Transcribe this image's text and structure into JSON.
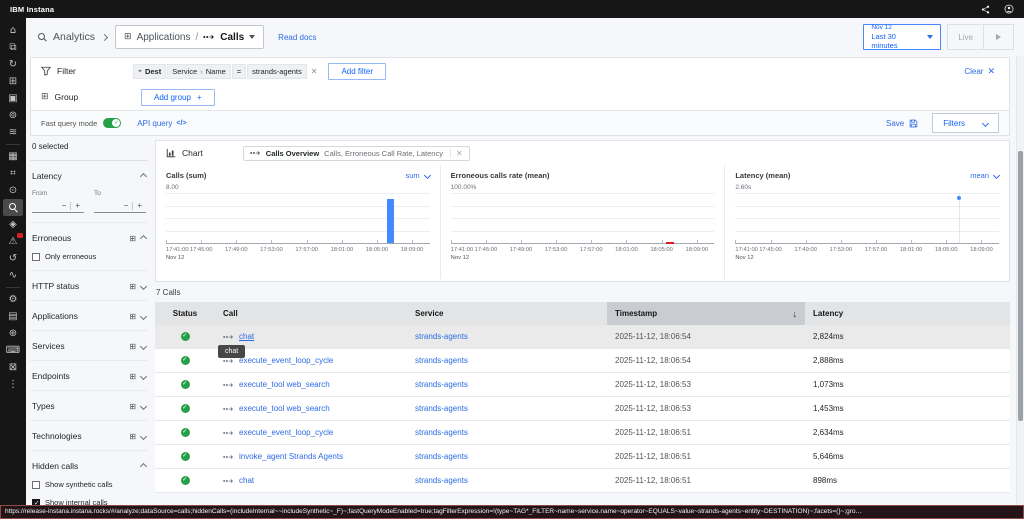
{
  "topbar": {
    "brand": "IBM Instana"
  },
  "rail": {
    "items": [
      {
        "name": "home",
        "glyph": "⌂"
      },
      {
        "name": "dashboards",
        "glyph": "⧉"
      },
      {
        "name": "deployments",
        "glyph": "↻"
      },
      {
        "name": "applications",
        "glyph": "⊞"
      },
      {
        "name": "ai-insights",
        "glyph": "▣"
      },
      {
        "name": "business-perspectives",
        "glyph": "⊚"
      },
      {
        "name": "platform",
        "glyph": "≋"
      },
      {
        "divider": true
      },
      {
        "name": "infrastructure",
        "glyph": "▦"
      },
      {
        "name": "websites",
        "glyph": "⌗"
      },
      {
        "name": "synthetic-monitoring",
        "glyph": "⊙"
      },
      {
        "name": "analytics",
        "glyph": "",
        "active": true,
        "magnifier": true
      },
      {
        "name": "application-security",
        "glyph": "◈"
      },
      {
        "name": "events",
        "glyph": "⚠",
        "badge": true
      },
      {
        "name": "automation",
        "glyph": "↺"
      },
      {
        "name": "service-levels",
        "glyph": "∿"
      },
      {
        "divider": true
      },
      {
        "name": "settings",
        "glyph": "⚙"
      },
      {
        "name": "documentation",
        "glyph": "▤"
      },
      {
        "name": "invite-users",
        "glyph": "⊕"
      },
      {
        "name": "integrations",
        "glyph": "⌨"
      },
      {
        "name": "lock",
        "glyph": "⊠"
      },
      {
        "name": "more",
        "glyph": "⋮"
      }
    ]
  },
  "header": {
    "analytics": "Analytics",
    "applications": "Applications",
    "calls": "Calls",
    "read_docs": "Read docs",
    "time_date": "Nov 12",
    "time_range": "Last 30 minutes",
    "live": "Live"
  },
  "filterbar": {
    "filter_label": "Filter",
    "chip_scope": "Dest",
    "chip_tag_group": "Service",
    "chip_tag_sep": "›",
    "chip_tag": "Name",
    "chip_operator": "=",
    "chip_value": "strands-agents",
    "add_filter": "Add filter",
    "clear": "Clear",
    "group_label": "Group",
    "add_group": "Add group",
    "add_group_plus": "+",
    "fast_query_mode": "Fast query mode",
    "api_query": "API query",
    "api_query_icon": "</>",
    "save": "Save",
    "filters_button": "Filters"
  },
  "facets": {
    "selected_count": "0 selected",
    "latency": {
      "label": "Latency",
      "from": "From",
      "to": "To",
      "minus": "−",
      "plus": "+"
    },
    "erroneous": {
      "label": "Erroneous",
      "only_erroneous": "Only erroneous"
    },
    "collapsed": [
      {
        "label": "HTTP status"
      },
      {
        "label": "Applications"
      },
      {
        "label": "Services"
      },
      {
        "label": "Endpoints"
      },
      {
        "label": "Types"
      },
      {
        "label": "Technologies"
      }
    ],
    "hidden_calls": {
      "label": "Hidden calls",
      "show_synthetic": "Show synthetic calls",
      "show_internal": "Show internal calls",
      "synthetic_checked": false,
      "internal_checked": true
    }
  },
  "chart_section": {
    "chart_label": "Chart",
    "chip_title": "Calls Overview",
    "chip_subtitle": "Calls, Erroneous Call Rate, Latency"
  },
  "chart_data": [
    {
      "type": "bar",
      "title": "Calls (sum)",
      "aggregation": "sum",
      "ylim": [
        0,
        8
      ],
      "ymax_label": "8.00",
      "axis_start": "17:41:00",
      "axis_minutes": 30,
      "x_ticks": [
        "17:41:00",
        "17:45:00",
        "17:49:00",
        "17:53:00",
        "17:57:00",
        "18:01:00",
        "18:05:00",
        "18:09:00"
      ],
      "x_date_label": "Nov 12",
      "grid": true,
      "series": [
        {
          "name": "Calls",
          "points": [
            {
              "x": "18:06:30",
              "value": 7
            }
          ]
        }
      ]
    },
    {
      "type": "line",
      "title": "Erroneous calls rate (mean)",
      "ylim": [
        0,
        100
      ],
      "ymax_label": "100.00%",
      "axis_start": "17:41:00",
      "axis_minutes": 30,
      "x_ticks": [
        "17:41:00",
        "17:45:00",
        "17:49:00",
        "17:53:00",
        "17:57:00",
        "18:01:00",
        "18:05:00",
        "18:09:00"
      ],
      "x_date_label": "Nov 12",
      "grid": true,
      "series": [
        {
          "name": "Erroneous calls rate",
          "points": [
            {
              "x": "18:06:00",
              "value": 0
            }
          ]
        }
      ]
    },
    {
      "type": "scatter",
      "title": "Latency (mean)",
      "aggregation": "mean",
      "ylim": [
        0,
        2.6
      ],
      "ymax_label": "2.60s",
      "axis_start": "17:41:00",
      "axis_minutes": 30,
      "x_ticks": [
        "17:41:00",
        "17:45:00",
        "17:49:00",
        "17:53:00",
        "17:57:00",
        "18:01:00",
        "18:05:00",
        "18:09:00"
      ],
      "x_date_label": "Nov 12",
      "grid": true,
      "series": [
        {
          "name": "Latency",
          "points": [
            {
              "x": "18:06:30",
              "value": 2.43
            }
          ]
        }
      ]
    }
  ],
  "table": {
    "count_label": "7 Calls",
    "columns": {
      "status": "Status",
      "call": "Call",
      "service": "Service",
      "timestamp": "Timestamp",
      "latency": "Latency"
    },
    "tooltip": "chat",
    "rows": [
      {
        "call": "chat",
        "service": "strands-agents",
        "timestamp": "2025-11-12, 18:06:54",
        "latency": "2,824ms"
      },
      {
        "call": "execute_event_loop_cycle",
        "service": "strands-agents",
        "timestamp": "2025-11-12, 18:06:54",
        "latency": "2,888ms"
      },
      {
        "call": "execute_tool web_search",
        "service": "strands-agents",
        "timestamp": "2025-11-12, 18:06:53",
        "latency": "1,073ms"
      },
      {
        "call": "execute_tool web_search",
        "service": "strands-agents",
        "timestamp": "2025-11-12, 18:06:53",
        "latency": "1,453ms"
      },
      {
        "call": "execute_event_loop_cycle",
        "service": "strands-agents",
        "timestamp": "2025-11-12, 18:06:51",
        "latency": "2,634ms"
      },
      {
        "call": "invoke_agent Strands Agents",
        "service": "strands-agents",
        "timestamp": "2025-11-12, 18:06:51",
        "latency": "5,646ms"
      },
      {
        "call": "chat",
        "service": "strands-agents",
        "timestamp": "2025-11-12, 18:06:51",
        "latency": "898ms"
      }
    ]
  },
  "statusbar": {
    "url": "https://release-instana.instana.rocks/#/analyze;dataSource=calls;hiddenCalls=(includeInternal~~includeSynthetic~_F)~;fastQueryModeEnabled=true;tagFilterExpression=!(type~TAG*_FILTER~name~service.name~operator~EQUALS~value~strands-agents~entity~DESTINATION)~;facets=(}~;gro…"
  },
  "colors": {
    "accent": "#0f62fe",
    "bar": "#4589ff",
    "error": "#da1e28",
    "success": "#24a148"
  }
}
